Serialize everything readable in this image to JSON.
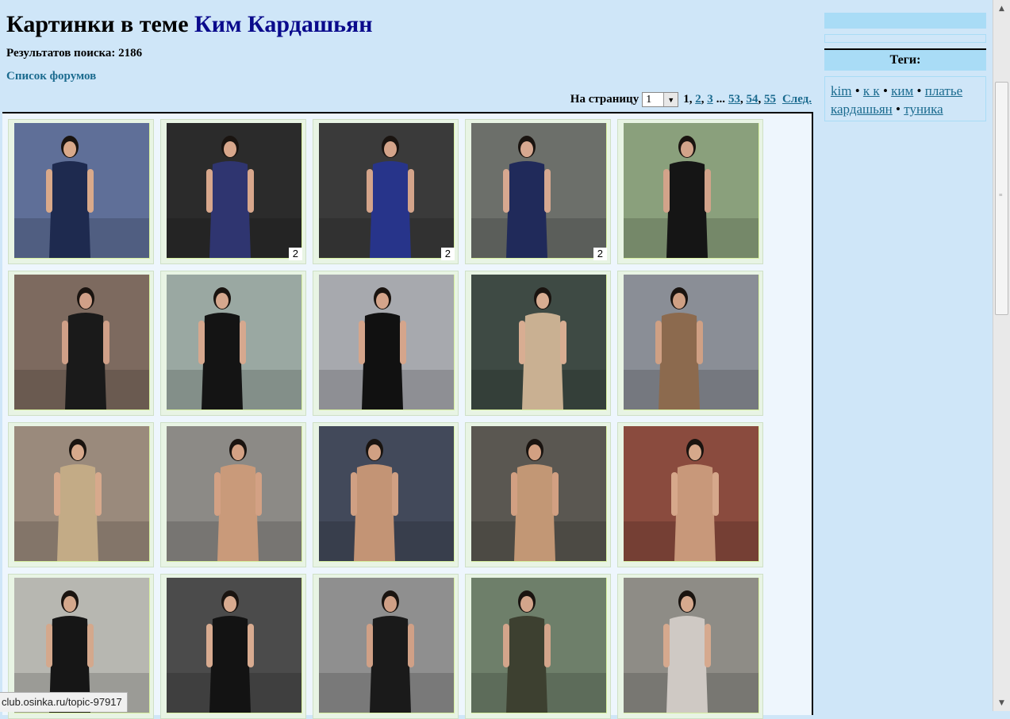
{
  "header": {
    "title_prefix": "Картинки в теме",
    "topic_name": "Ким Кардашьян",
    "results": "Результатов поиска: 2186",
    "forums_link": "Список форумов"
  },
  "pager": {
    "label": "На страницу",
    "select_value": "1",
    "current": "1",
    "pages": [
      "2",
      "3",
      "53",
      "54",
      "55"
    ],
    "ellipsis": "...",
    "next": "След."
  },
  "gallery": {
    "thumbs": [
      {
        "count": "",
        "bg": "#5f6f98",
        "fg": "#1e2a4f",
        "skin": "#d9a98a"
      },
      {
        "count": "2",
        "bg": "#2b2b2b",
        "fg": "#2f3570",
        "skin": "#d8a78c"
      },
      {
        "count": "2",
        "bg": "#3a3a3a",
        "fg": "#27348a",
        "skin": "#d4a48a"
      },
      {
        "count": "2",
        "bg": "#6c6f6a",
        "fg": "#202a5a",
        "skin": "#d7a890"
      },
      {
        "count": "",
        "bg": "#8aa07c",
        "fg": "#151515",
        "skin": "#d2a38a"
      },
      {
        "count": "",
        "bg": "#7d6a5f",
        "fg": "#1a1a1a",
        "skin": "#d0a088"
      },
      {
        "count": "",
        "bg": "#9aa8a2",
        "fg": "#141414",
        "skin": "#d6a88e"
      },
      {
        "count": "",
        "bg": "#a7a9ae",
        "fg": "#111111",
        "skin": "#d5a58b"
      },
      {
        "count": "",
        "bg": "#3e4a44",
        "fg": "#c9b092",
        "skin": "#d8ad92"
      },
      {
        "count": "",
        "bg": "#8a8e96",
        "fg": "#8c6a4e",
        "skin": "#cfa084"
      },
      {
        "count": "",
        "bg": "#9a8a7c",
        "fg": "#c3ab86",
        "skin": "#d7a98c"
      },
      {
        "count": "",
        "bg": "#8c8a86",
        "fg": "#c99a7a",
        "skin": "#d3a184"
      },
      {
        "count": "",
        "bg": "#42495a",
        "fg": "#c39475",
        "skin": "#d0a083"
      },
      {
        "count": "",
        "bg": "#5a5751",
        "fg": "#c29775",
        "skin": "#d2a082"
      },
      {
        "count": "",
        "bg": "#8a4b3e",
        "fg": "#c8987a",
        "skin": "#d6a88b"
      },
      {
        "count": "",
        "bg": "#b7b7b1",
        "fg": "#161616",
        "skin": "#d4a88c"
      },
      {
        "count": "",
        "bg": "#4b4b4b",
        "fg": "#131313",
        "skin": "#d8ab90"
      },
      {
        "count": "",
        "bg": "#8f8f8f",
        "fg": "#1a1a1a",
        "skin": "#d0a086"
      },
      {
        "count": "",
        "bg": "#6e7f6a",
        "fg": "#3d4030",
        "skin": "#d3a58b"
      },
      {
        "count": "",
        "bg": "#8e8c86",
        "fg": "#cfc9c4",
        "skin": "#d6a98e"
      }
    ]
  },
  "sidebar": {
    "tags_heading": "Теги:",
    "tags": [
      "kim",
      "к к",
      "ким",
      "платье",
      "кардашьян",
      "туника"
    ],
    "separator": "•"
  },
  "scrollbar": {
    "up_icon": "▲",
    "down_icon": "▼"
  },
  "status_bar": {
    "url": "club.osinka.ru/topic-97917"
  }
}
